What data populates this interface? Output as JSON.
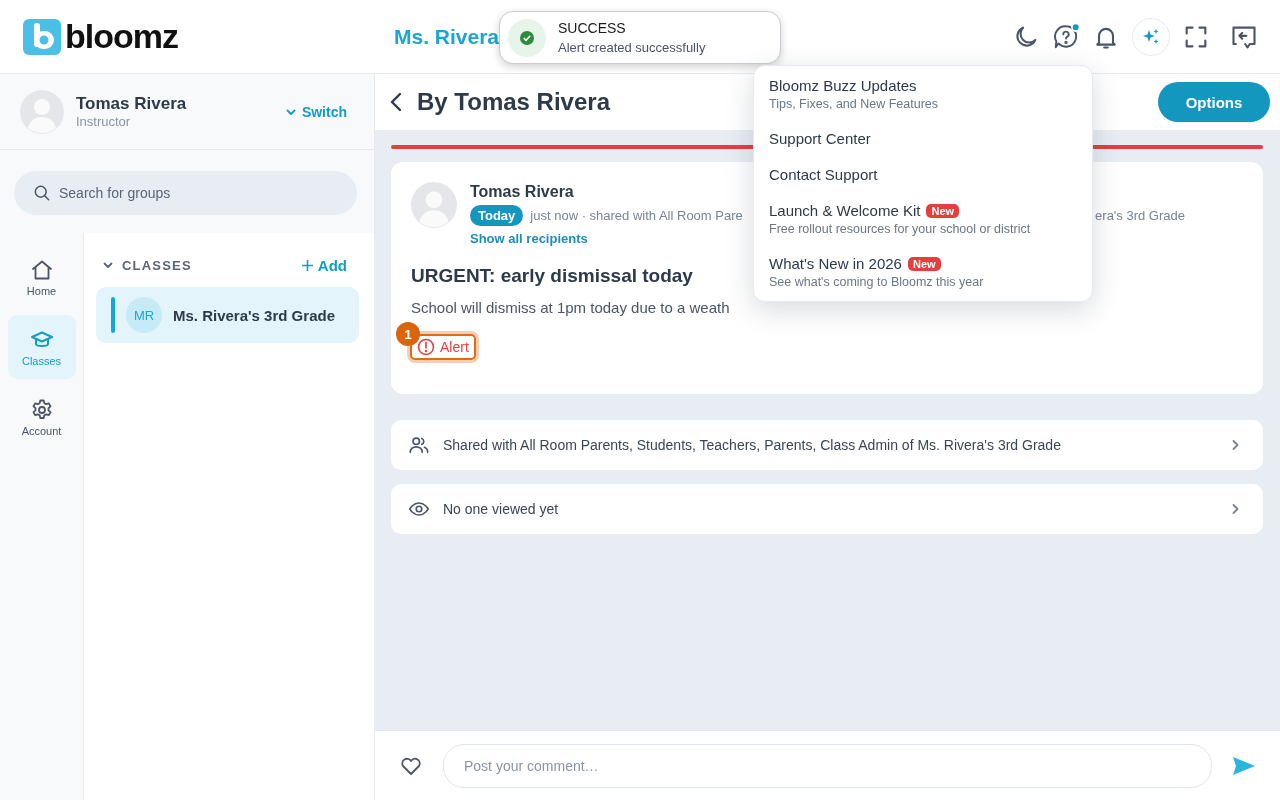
{
  "header": {
    "logo": "bloomz",
    "title": "Ms. Rivera"
  },
  "toast": {
    "kind": "success",
    "title": "SUCCESS",
    "message": "Alert created successfully"
  },
  "profile": {
    "name": "Tomas Rivera",
    "role": "Instructor",
    "switch": "Switch"
  },
  "search": {
    "placeholder": "Search for groups"
  },
  "nav": [
    {
      "label": "Home",
      "selected": false
    },
    {
      "label": "Classes",
      "selected": true
    },
    {
      "label": "Account",
      "selected": false
    }
  ],
  "classes": {
    "heading": "CLASSES",
    "expanded": true,
    "add": "Add",
    "items": [
      {
        "initials": "MR",
        "name": "Ms. Rivera's 3rd Grade",
        "selected": true
      }
    ]
  },
  "post_view": {
    "title": "By Tomas Rivera",
    "options": "Options",
    "post": {
      "author": "Tomas Rivera",
      "date_badge": "Today",
      "meta": "just now · shared with All Room Pare",
      "meta_tail": "era's 3rd Grade",
      "recipients_link": "Show all recipients",
      "title": "URGENT: early dismissal today",
      "body": "School will dismiss at 1pm today due to a weath",
      "tag": {
        "label": "Alert",
        "count": "1"
      }
    },
    "info_rows": [
      {
        "text": "Shared with All Room Parents, Students, Teachers, Parents, Class Admin of Ms. Rivera's 3rd Grade"
      },
      {
        "text": "No one viewed yet"
      }
    ]
  },
  "comment": {
    "placeholder": "Post your comment…"
  },
  "help_menu": [
    {
      "title": "Bloomz Buzz Updates",
      "subtitle": "Tips, Fixes, and New Features"
    },
    {
      "title": "Support Center"
    },
    {
      "title": "Contact Support"
    },
    {
      "title": "Launch & Welcome Kit",
      "badge": "New",
      "subtitle": "Free rollout resources for your school or district"
    },
    {
      "title": "What's New in 2026",
      "badge": "New",
      "subtitle": "See what's coming to Bloomz this year"
    }
  ]
}
